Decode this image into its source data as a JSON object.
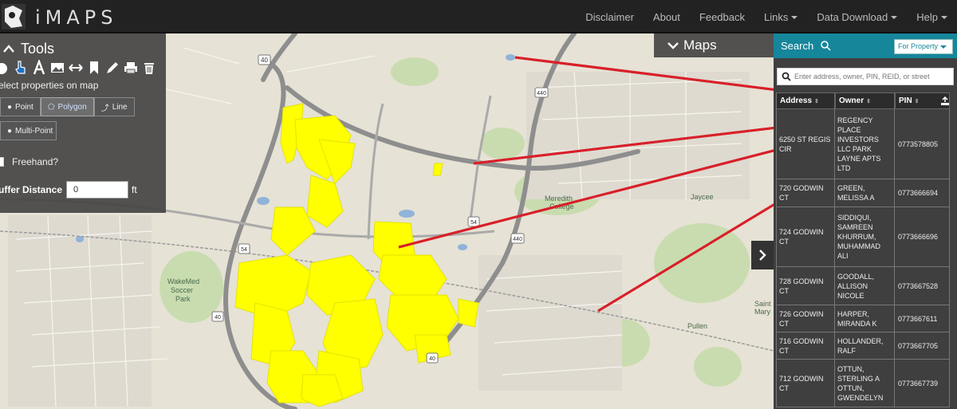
{
  "app": {
    "title": "iMAPS"
  },
  "nav": {
    "items": [
      {
        "label": "Disclaimer",
        "caret": false
      },
      {
        "label": "About",
        "caret": false
      },
      {
        "label": "Feedback",
        "caret": false
      },
      {
        "label": "Links",
        "caret": true
      },
      {
        "label": "Data Download",
        "caret": true
      },
      {
        "label": "Help",
        "caret": true
      }
    ]
  },
  "tools": {
    "title": "Tools",
    "icons": [
      "identify-icon",
      "select-hand-icon",
      "measure-icon",
      "image-icon",
      "distance-icon",
      "bookmark-icon",
      "draw-icon",
      "print-icon",
      "trash-icon"
    ],
    "select_label": "elect properties on map",
    "point_label": "Point",
    "polygon_label": "Polygon",
    "line_label": "Line",
    "multipoint_label": "Multi-Point",
    "freehand_label": "Freehand?",
    "buffer_label": "uffer Distance",
    "buffer_value": "0",
    "buffer_unit": "ft"
  },
  "maps": {
    "title": "Maps"
  },
  "search": {
    "title": "Search",
    "scope": "For Property",
    "placeholder": "Enter address, owner, PIN, REID, or street"
  },
  "results": {
    "columns": [
      "Address",
      "Owner",
      "PIN"
    ],
    "rows": [
      {
        "address": "6250 ST REGIS CIR",
        "owner": "REGENCY PLACE INVESTORS LLC PARK LAYNE APTS LTD",
        "pin": "0773578805"
      },
      {
        "address": "720 GODWIN CT",
        "owner": "GREEN, MELISSA A",
        "pin": "0773666694"
      },
      {
        "address": "724 GODWIN CT",
        "owner": "SIDDIQUI, SAMREEN KHURRUM, MUHAMMAD ALI",
        "pin": "0773666696"
      },
      {
        "address": "728 GODWIN CT",
        "owner": "GOODALL, ALLISON NICOLE",
        "pin": "0773667528"
      },
      {
        "address": "726 GODWIN CT",
        "owner": "HARPER, MIRANDA K",
        "pin": "0773667611"
      },
      {
        "address": "716 GODWIN CT",
        "owner": "HOLLANDER, RALF",
        "pin": "0773667705"
      },
      {
        "address": "712 GODWIN CT",
        "owner": "OTTUN, STERLING A OTTUN, GWENDELYN",
        "pin": "0773667739"
      }
    ]
  },
  "map_labels": {
    "hwy40_a": "40",
    "hwy40_b": "40",
    "hwy40_c": "40",
    "hwy440_a": "440",
    "hwy440_b": "440",
    "hwy54_a": "54",
    "hwy54_b": "54",
    "wakemed": "WakeMed",
    "soccer": "Soccer",
    "park": "Park",
    "meredith": "Meredith",
    "college": "College",
    "jaycee": "Jaycee",
    "pullen": "Pullen",
    "saint": "Saint",
    "mary": "Mary"
  },
  "colors": {
    "selection": "#ffff00",
    "annotation": "#d8202a",
    "accent": "#16869b",
    "panel": "#464646"
  }
}
